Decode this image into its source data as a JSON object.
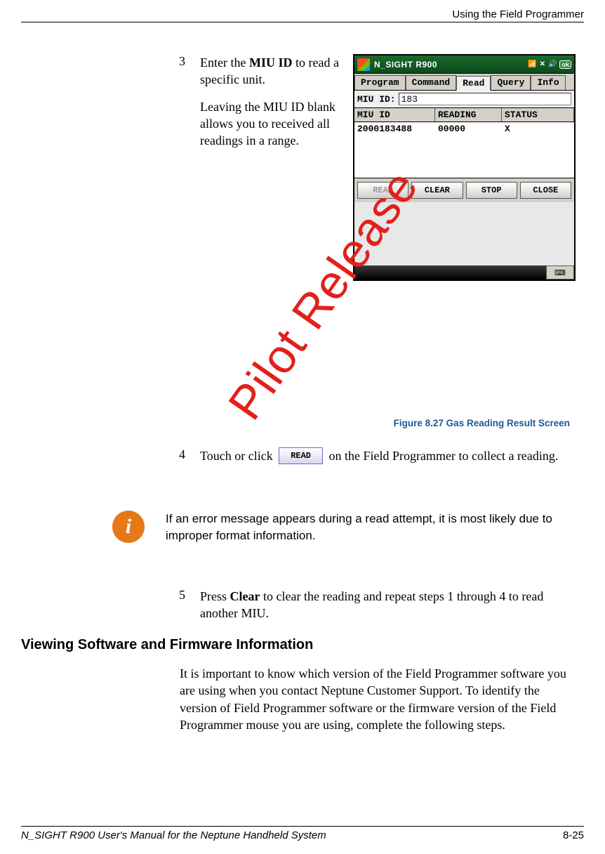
{
  "header": {
    "title": "Using the Field Programmer"
  },
  "watermark": "Pilot Release",
  "steps": {
    "s3": {
      "num": "3",
      "text_a": "Enter the ",
      "bold_a": "MIU ID",
      "text_b": " to read a specific unit.",
      "para2": "Leaving the MIU ID blank allows you to received all readings in a range."
    },
    "s4": {
      "num": "4",
      "text_a": "Touch or click ",
      "btn": "READ",
      "text_b": " on the Field Programmer to collect a reading."
    },
    "s5": {
      "num": "5",
      "text_a": "Press ",
      "bold_a": "Clear",
      "text_b": " to clear the reading and repeat steps 1 through 4 to read another MIU."
    }
  },
  "info_note": "If an error message appears during a read attempt, it is most likely due to improper format information.",
  "section_heading": "Viewing Software and Firmware Information",
  "body_para": "It is important to know which version of the Field Programmer software you are using when you contact Neptune Customer Support. To identify the version of Field Programmer software or the firmware version of the Field Programmer mouse you are using, complete the following steps.",
  "figure": {
    "label": "Figure 8.27   Gas Reading Result Screen"
  },
  "screenshot": {
    "title": "N_SIGHT R900",
    "ok": "ok",
    "tabs": [
      "Program",
      "Command",
      "Read",
      "Query",
      "Info"
    ],
    "active_tab_index": 2,
    "form": {
      "label": "MIU ID:",
      "value": "183"
    },
    "columns": [
      "MIU ID",
      "READING",
      "STATUS"
    ],
    "rows": [
      {
        "id": "2000183488",
        "reading": "00000",
        "status": "X"
      }
    ],
    "buttons": [
      "READ",
      "CLEAR",
      "STOP",
      "CLOSE"
    ],
    "disabled_index": 0
  },
  "footer": {
    "left": "N_SIGHT R900 User's Manual for the Neptune Handheld System",
    "right": "8-25"
  }
}
